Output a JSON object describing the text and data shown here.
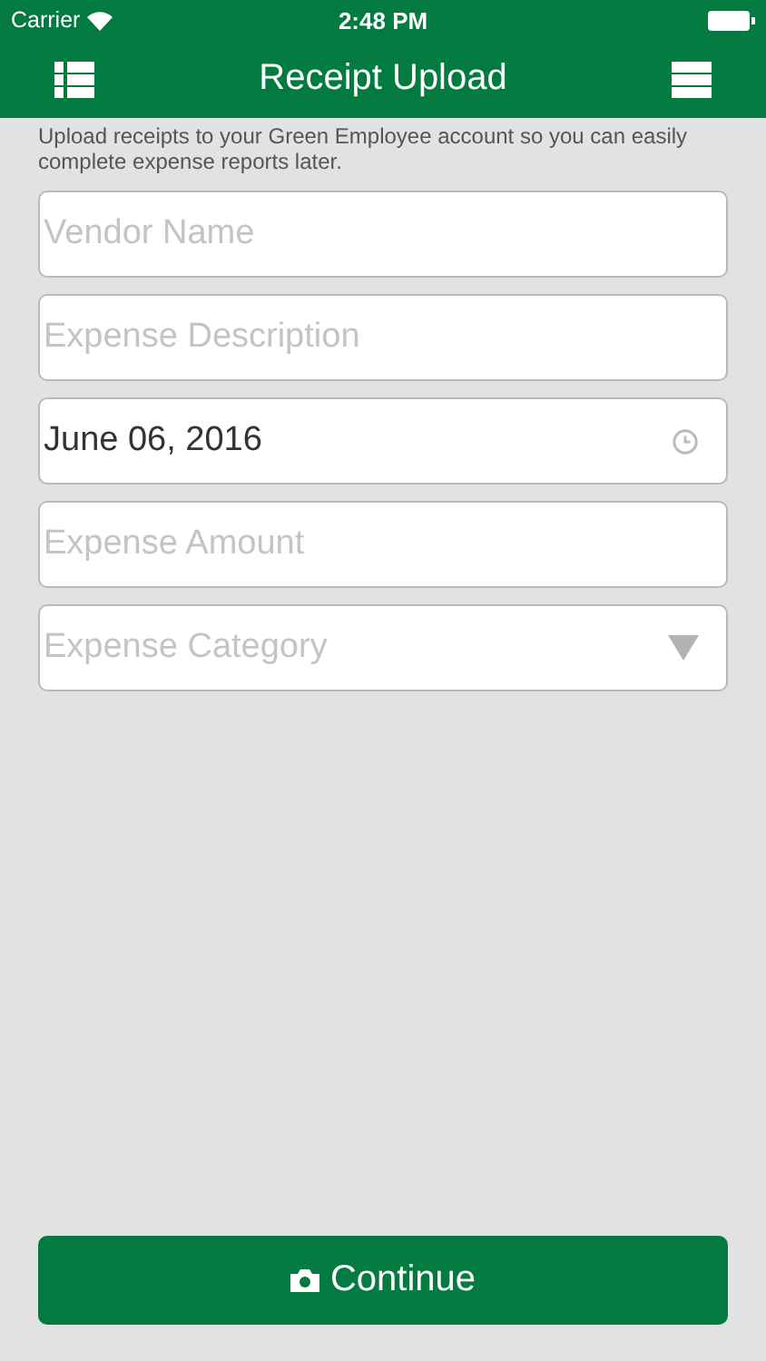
{
  "status_bar": {
    "carrier": "Carrier",
    "time": "2:48 PM"
  },
  "nav": {
    "title": "Receipt Upload"
  },
  "intro": "Upload receipts to your Green Employee account so you can easily complete expense reports later.",
  "fields": [
    {
      "kind": "text",
      "placeholder": "Vendor Name"
    },
    {
      "kind": "text",
      "placeholder": "Expense Description"
    },
    {
      "kind": "date",
      "value": "June 06, 2016"
    },
    {
      "kind": "text",
      "placeholder": "Expense Amount"
    },
    {
      "kind": "select",
      "placeholder": "Expense Category"
    }
  ],
  "continue_button": {
    "label": "Continue"
  }
}
